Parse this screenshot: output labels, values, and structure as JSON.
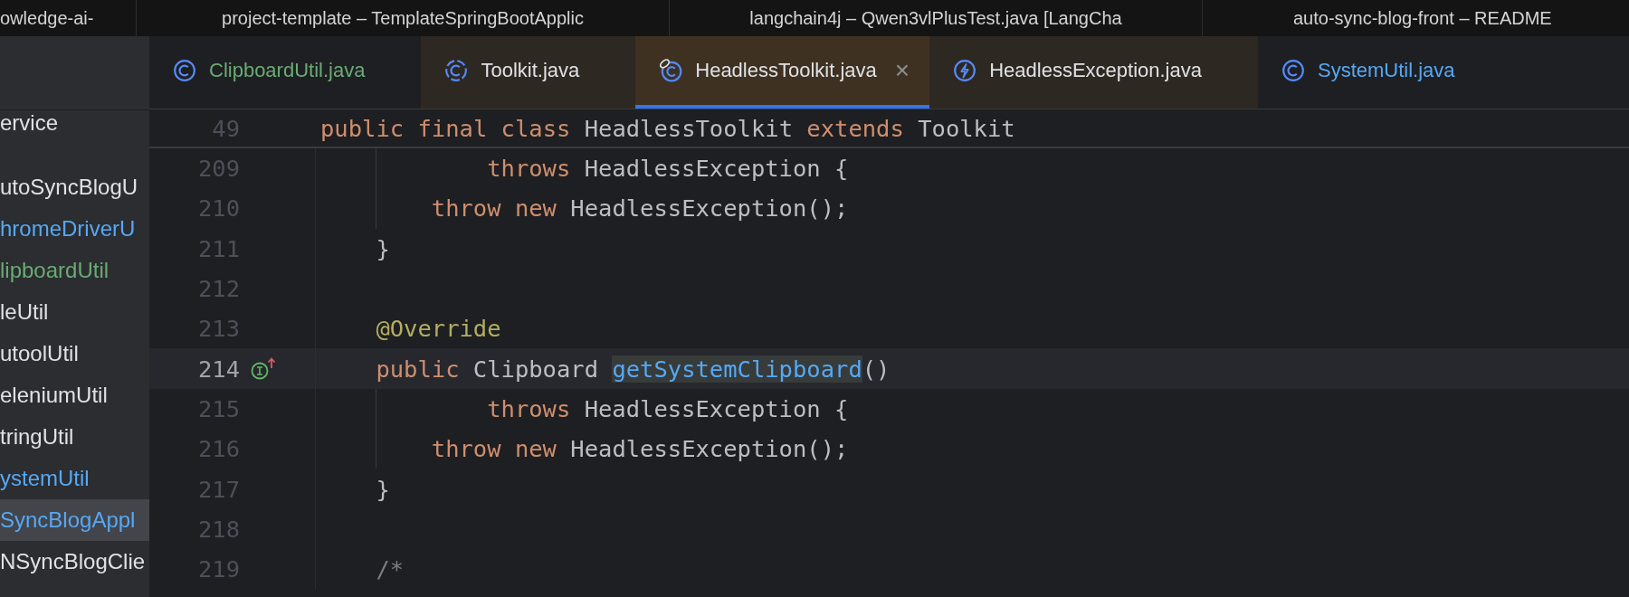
{
  "window_tabs": [
    {
      "title": "owledge-ai-"
    },
    {
      "title": "project-template – TemplateSpringBootApplic"
    },
    {
      "title": "langchain4j – Qwen3vlPlusTest.java [LangCha"
    },
    {
      "title": "auto-sync-blog-front – README"
    }
  ],
  "sidebar": {
    "items": [
      {
        "label": "ervice",
        "color": "#dfe1e5",
        "selected": false
      },
      {
        "label": "utoSyncBlogU",
        "color": "#dfe1e5",
        "selected": false
      },
      {
        "label": "hromeDriverU",
        "color": "#56a8f5",
        "selected": false
      },
      {
        "label": "lipboardUtil",
        "color": "#6aab73",
        "selected": false
      },
      {
        "label": "leUtil",
        "color": "#dfe1e5",
        "selected": false
      },
      {
        "label": "utoolUtil",
        "color": "#dfe1e5",
        "selected": false
      },
      {
        "label": "eleniumUtil",
        "color": "#dfe1e5",
        "selected": false
      },
      {
        "label": "tringUtil",
        "color": "#dfe1e5",
        "selected": false
      },
      {
        "label": "ystemUtil",
        "color": "#56a8f5",
        "selected": false
      },
      {
        "label": "SyncBlogAppl",
        "color": "#56a8f5",
        "selected": true
      },
      {
        "label": "NSyncBlogClie",
        "color": "#dfe1e5",
        "selected": false
      }
    ]
  },
  "editor_tabs": [
    {
      "label": "ClipboardUtil.java",
      "kind": "class",
      "color": "#6aab73",
      "tinted": false,
      "selected": false
    },
    {
      "label": "Toolkit.java",
      "kind": "abstract",
      "color": "#dfe1e5",
      "tinted": true,
      "selected": false
    },
    {
      "label": "HeadlessToolkit.java",
      "kind": "final",
      "color": "#dfe1e5",
      "tinted": true,
      "selected": true,
      "close": "×"
    },
    {
      "label": "HeadlessException.java",
      "kind": "exception",
      "color": "#dfe1e5",
      "tinted": true,
      "selected": false
    },
    {
      "label": "SystemUtil.java",
      "kind": "class",
      "color": "#56a8f5",
      "tinted": false,
      "selected": false
    }
  ],
  "sticky_line": {
    "number": "49",
    "tokens": [
      {
        "kind": "keyword",
        "text": "public final class "
      },
      {
        "kind": "plain",
        "text": "HeadlessToolkit "
      },
      {
        "kind": "keyword",
        "text": "extends "
      },
      {
        "kind": "plain",
        "text": "Toolkit"
      }
    ]
  },
  "code_lines": [
    {
      "number": "209",
      "current": false,
      "gutter_icon": false,
      "kind": "continuation",
      "tokens": [
        {
          "kind": "keyword",
          "text": "throws "
        },
        {
          "kind": "plain",
          "text": "HeadlessException {"
        }
      ]
    },
    {
      "number": "210",
      "current": false,
      "gutter_icon": false,
      "kind": "body",
      "tokens": [
        {
          "kind": "keyword",
          "text": "throw new "
        },
        {
          "kind": "plain",
          "text": "HeadlessException();"
        }
      ]
    },
    {
      "number": "211",
      "current": false,
      "gutter_icon": false,
      "kind": "member",
      "tokens": [
        {
          "kind": "plain",
          "text": "}"
        }
      ]
    },
    {
      "number": "212",
      "current": false,
      "gutter_icon": false,
      "kind": "blank"
    },
    {
      "number": "213",
      "current": false,
      "gutter_icon": false,
      "kind": "member",
      "tokens": [
        {
          "kind": "annotation",
          "text": "@Override"
        }
      ]
    },
    {
      "number": "214",
      "current": true,
      "gutter_icon": true,
      "kind": "member",
      "tokens": [
        {
          "kind": "keyword",
          "text": "public "
        },
        {
          "kind": "plain",
          "text": "Clipboard "
        },
        {
          "kind": "method",
          "text": "getSystemClipboard"
        },
        {
          "kind": "plain",
          "text": "()"
        }
      ]
    },
    {
      "number": "215",
      "current": false,
      "gutter_icon": false,
      "kind": "continuation",
      "tokens": [
        {
          "kind": "keyword",
          "text": "throws "
        },
        {
          "kind": "plain",
          "text": "HeadlessException {"
        }
      ]
    },
    {
      "number": "216",
      "current": false,
      "gutter_icon": false,
      "kind": "body",
      "tokens": [
        {
          "kind": "keyword",
          "text": "throw new "
        },
        {
          "kind": "plain",
          "text": "HeadlessException();"
        }
      ]
    },
    {
      "number": "217",
      "current": false,
      "gutter_icon": false,
      "kind": "member",
      "tokens": [
        {
          "kind": "plain",
          "text": "}"
        }
      ]
    },
    {
      "number": "218",
      "current": false,
      "gutter_icon": false,
      "kind": "blank"
    },
    {
      "number": "219",
      "current": false,
      "gutter_icon": false,
      "kind": "member",
      "tokens": [
        {
          "kind": "comment",
          "text": "/*"
        }
      ]
    }
  ]
}
